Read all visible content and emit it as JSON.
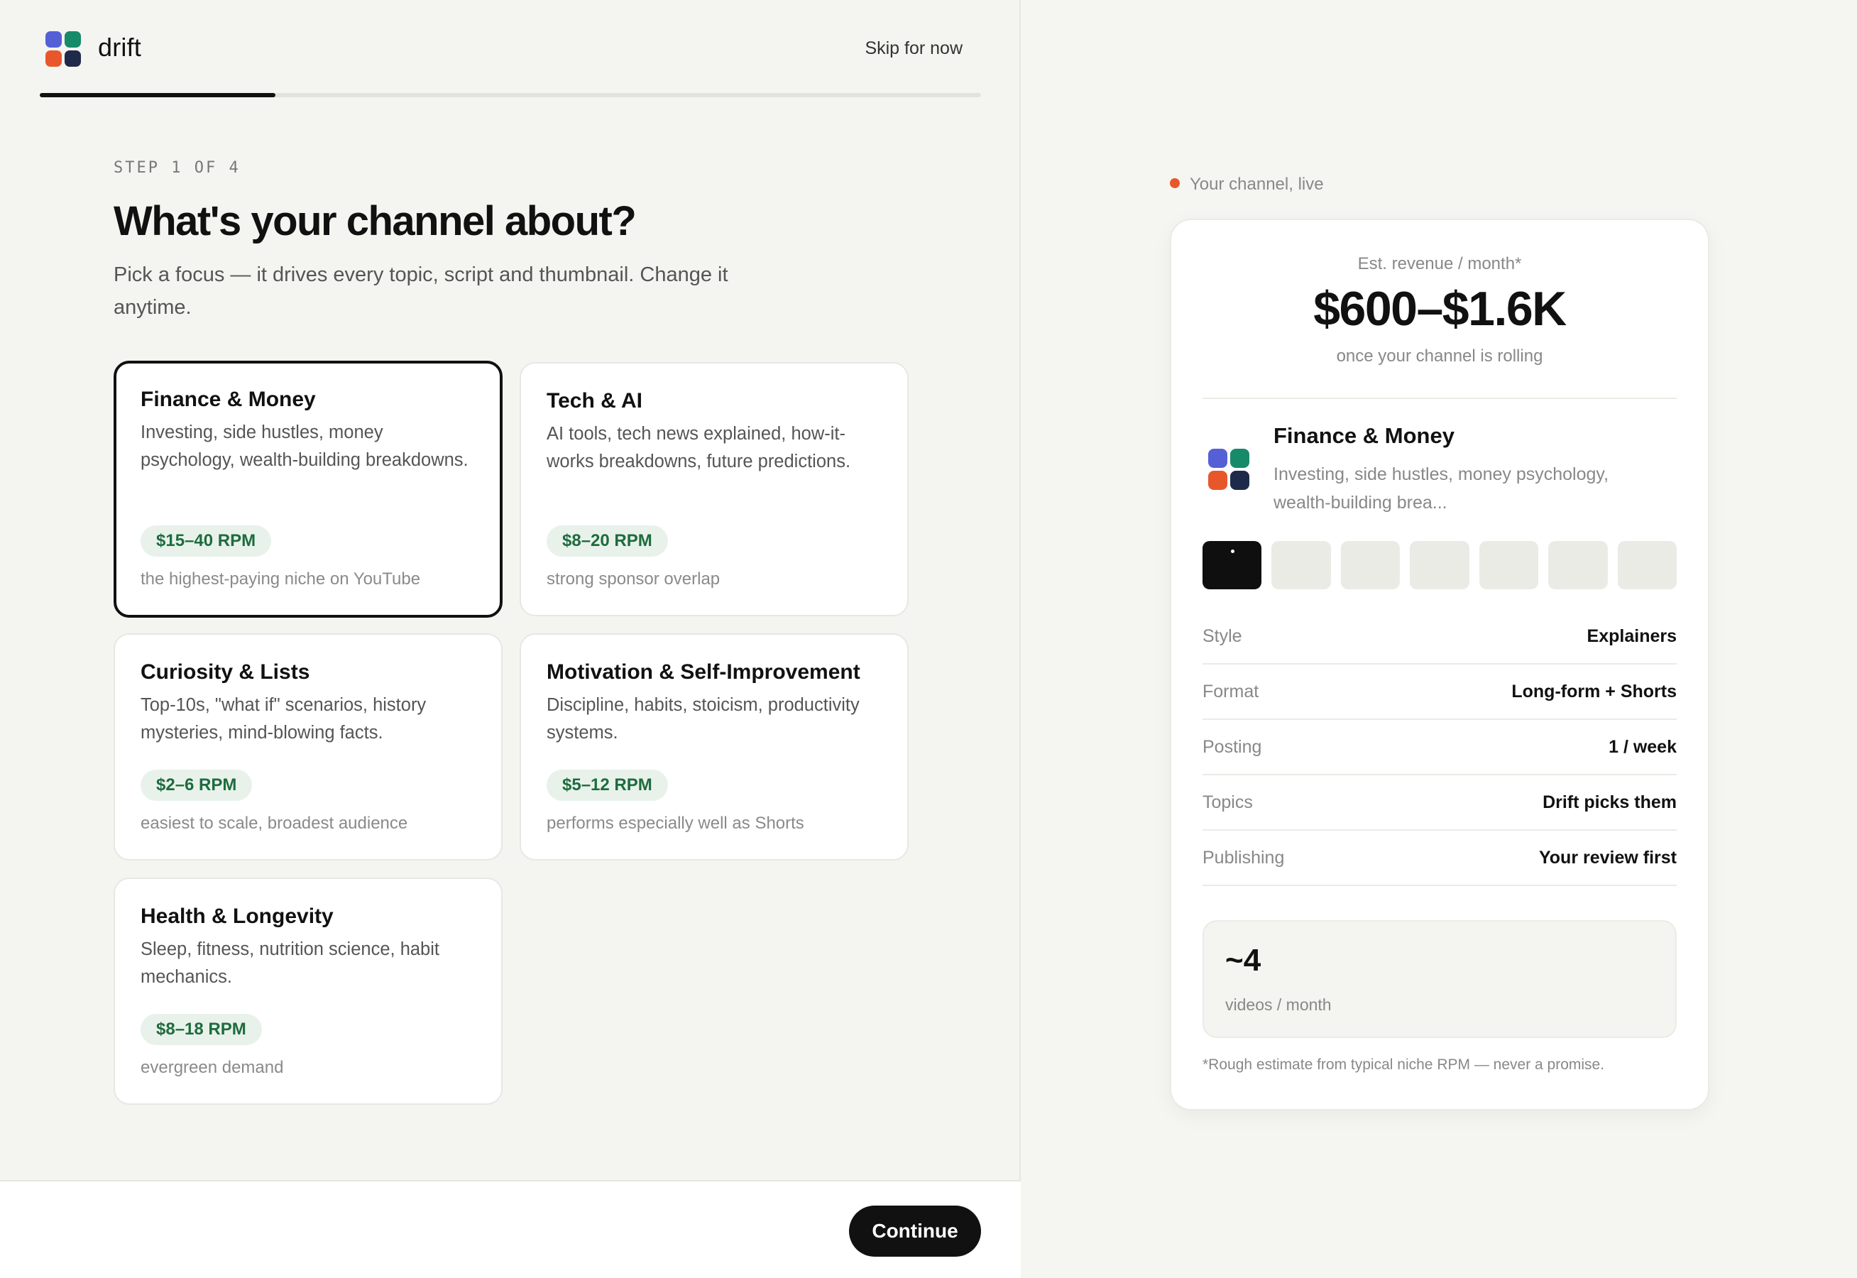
{
  "app": {
    "brand": "drift",
    "skip_label": "Skip for now",
    "continue_label": "Continue"
  },
  "progress": {
    "value": 0.25
  },
  "step": {
    "label": "STEP 1 OF 4"
  },
  "page": {
    "title": "What's your channel about?",
    "subtitle": "Pick a focus — it drives every topic, script and thumbnail. Change it anytime."
  },
  "niches": [
    {
      "title": "Finance & Money",
      "desc": "Investing, side hustles, money psychology, wealth-building breakdowns.",
      "rpm": "$15–40 RPM",
      "note": "the highest-paying niche on YouTube",
      "selected": true
    },
    {
      "title": "Tech & AI",
      "desc": "AI tools, tech news explained, how-it-works breakdowns, future predictions.",
      "rpm": "$8–20 RPM",
      "note": "strong sponsor overlap",
      "selected": false
    },
    {
      "title": "Curiosity & Lists",
      "desc": "Top-10s, \"what if\" scenarios, history mysteries, mind-blowing facts.",
      "rpm": "$2–6 RPM",
      "note": "easiest to scale, broadest audience",
      "selected": false
    },
    {
      "title": "Motivation & Self-Improvement",
      "desc": "Discipline, habits, stoicism, productivity systems.",
      "rpm": "$5–12 RPM",
      "note": "performs especially well as Shorts",
      "selected": false
    },
    {
      "title": "Health & Longevity",
      "desc": "Sleep, fitness, nutrition science, habit mechanics.",
      "rpm": "$8–18 RPM",
      "note": "evergreen demand",
      "selected": false
    }
  ],
  "preview": {
    "live_label": "Your channel, live",
    "revenue_label": "Est. revenue / month*",
    "revenue_value": "$600–$1.6K",
    "revenue_sub": "once your channel is rolling",
    "channel_name": "Finance & Money",
    "channel_desc": "Investing, side hustles, money psychology, wealth-building brea...",
    "thumbnails_count": 7,
    "active_thumbnail": 0,
    "rows": [
      {
        "key": "Style",
        "value": "Explainers"
      },
      {
        "key": "Format",
        "value": "Long-form + Shorts"
      },
      {
        "key": "Posting",
        "value": "1 / week"
      },
      {
        "key": "Topics",
        "value": "Drift picks them"
      },
      {
        "key": "Publishing",
        "value": "Your review first"
      }
    ],
    "stat_value": "~4",
    "stat_label": "videos / month",
    "disclaimer": "*Rough estimate from typical niche RPM — never a promise."
  },
  "colors": {
    "accent": "#111111",
    "rpm_text": "#1e6c3e",
    "rpm_bg": "#e8f2ea",
    "live_dot": "#e8572b",
    "logo": [
      "#5560d6",
      "#178a6a",
      "#e8572b",
      "#1f2a4a"
    ]
  },
  "icons": {
    "logo": "drift-logo-icon",
    "live": "live-dot-icon"
  }
}
